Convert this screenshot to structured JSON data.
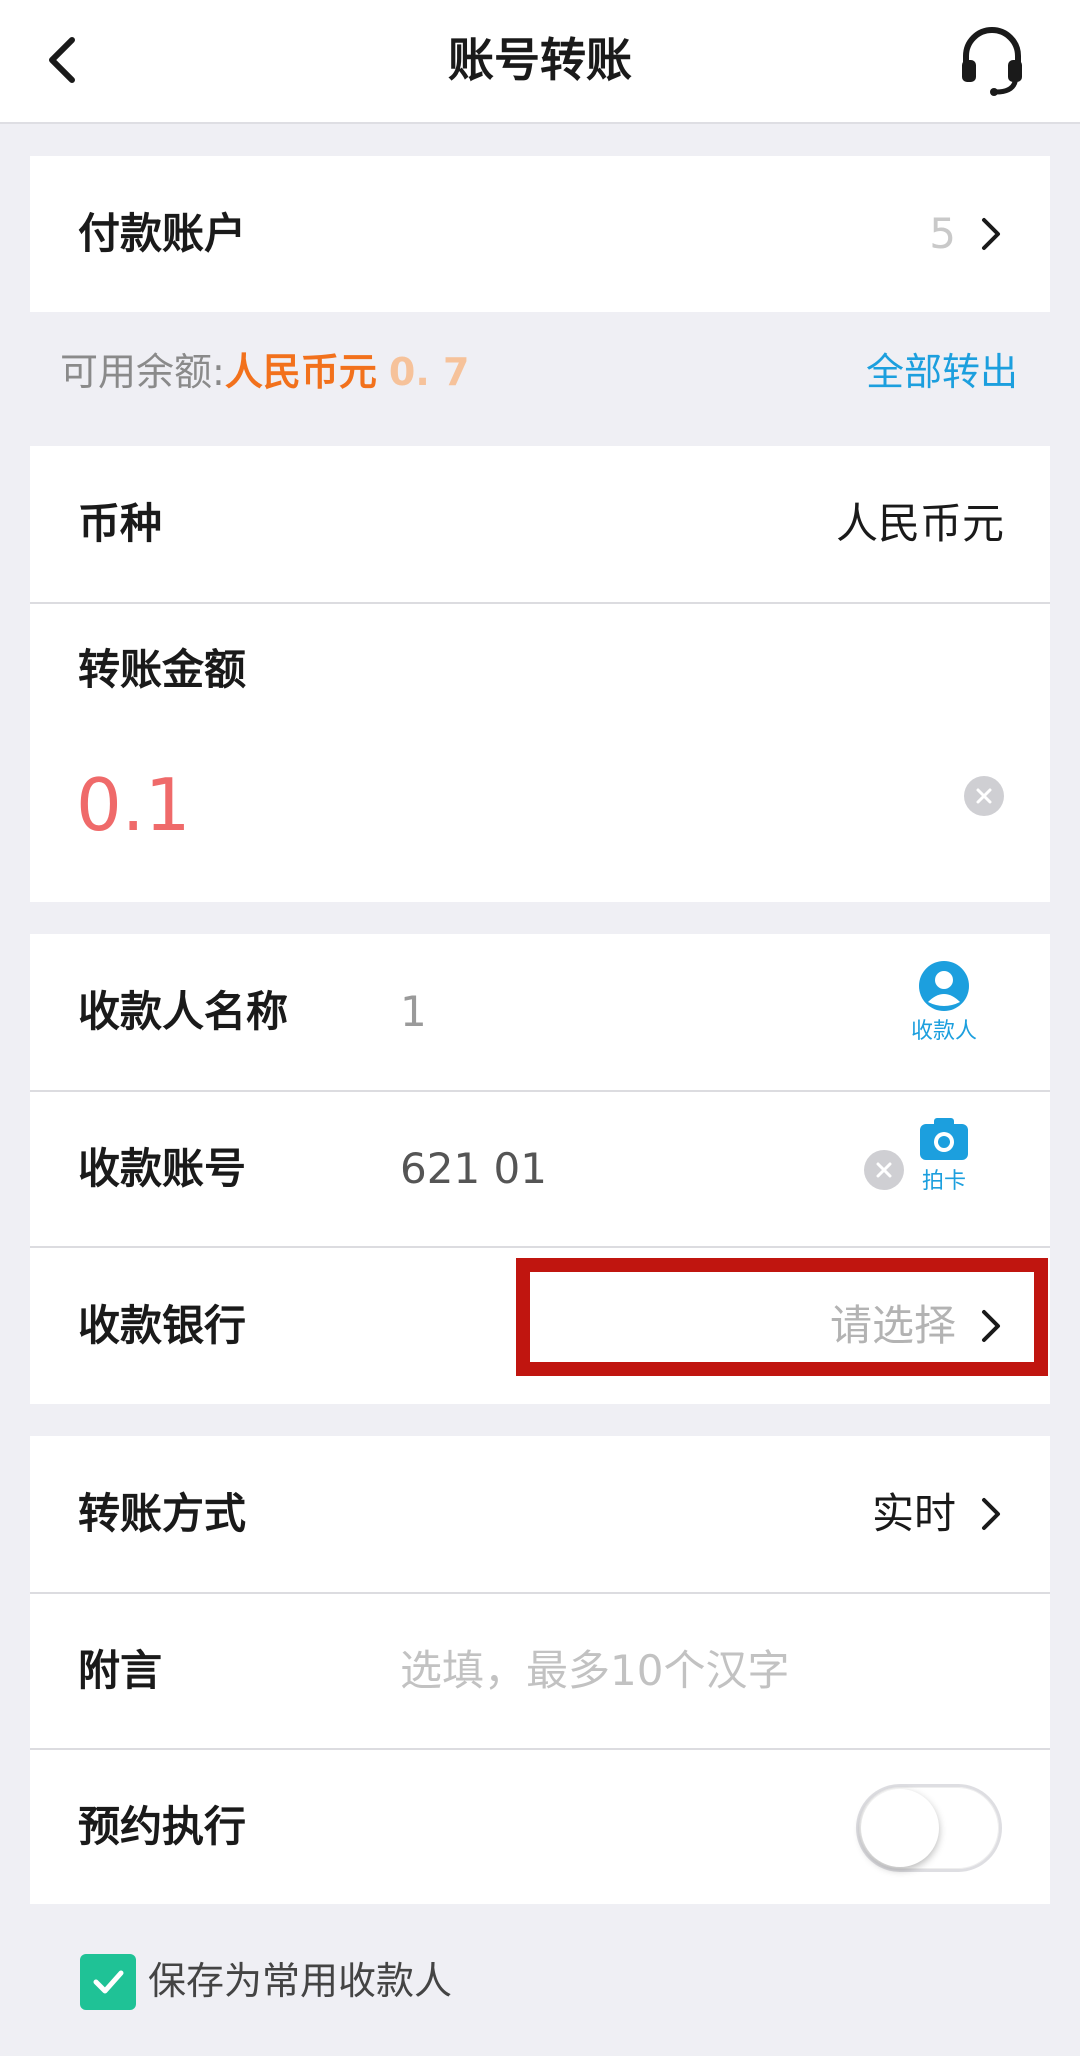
{
  "header": {
    "title": "账号转账"
  },
  "payment_account": {
    "label": "付款账户",
    "masked_value": "5"
  },
  "balance": {
    "prefix": "可用余额:",
    "currency": "人民币元",
    "amount": "0. 7",
    "transfer_all": "全部转出"
  },
  "currency_row": {
    "label": "币种",
    "value": "人民币元"
  },
  "amount_row": {
    "label": "转账金额",
    "value": "0.1"
  },
  "payee_name": {
    "label": "收款人名称",
    "value": "1",
    "action_label": "收款人"
  },
  "payee_account": {
    "label": "收款账号",
    "value": "621 01",
    "action_label": "拍卡"
  },
  "payee_bank": {
    "label": "收款银行",
    "placeholder": "请选择"
  },
  "transfer_method": {
    "label": "转账方式",
    "value": "实时"
  },
  "note": {
    "label": "附言",
    "placeholder": "选填，最多10个汉字"
  },
  "schedule": {
    "label": "预约执行",
    "enabled": false
  },
  "save_payee": {
    "label": "保存为常用收款人",
    "checked": true
  },
  "colors": {
    "accent_blue": "#1c9fde",
    "accent_orange": "#f2711c",
    "amount_red": "#ef6a6a",
    "check_green": "#1fc296",
    "highlight_red": "#c0150f"
  }
}
